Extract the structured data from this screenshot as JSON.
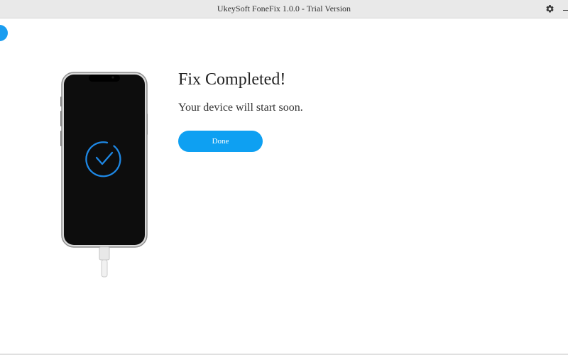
{
  "window": {
    "title": "UkeySoft FoneFix 1.0.0 - Trial Version"
  },
  "icons": {
    "settings": "gear-icon",
    "minimize": "minimize-icon",
    "back": "back-circle-icon",
    "checkmark": "check-circle-icon"
  },
  "main": {
    "title": "Fix Completed!",
    "subtitle": "Your device will start soon.",
    "done_label": "Done"
  },
  "colors": {
    "accent": "#0ea0f2",
    "check_ring": "#1e88e5",
    "phone_screen": "#0d0d0d"
  }
}
